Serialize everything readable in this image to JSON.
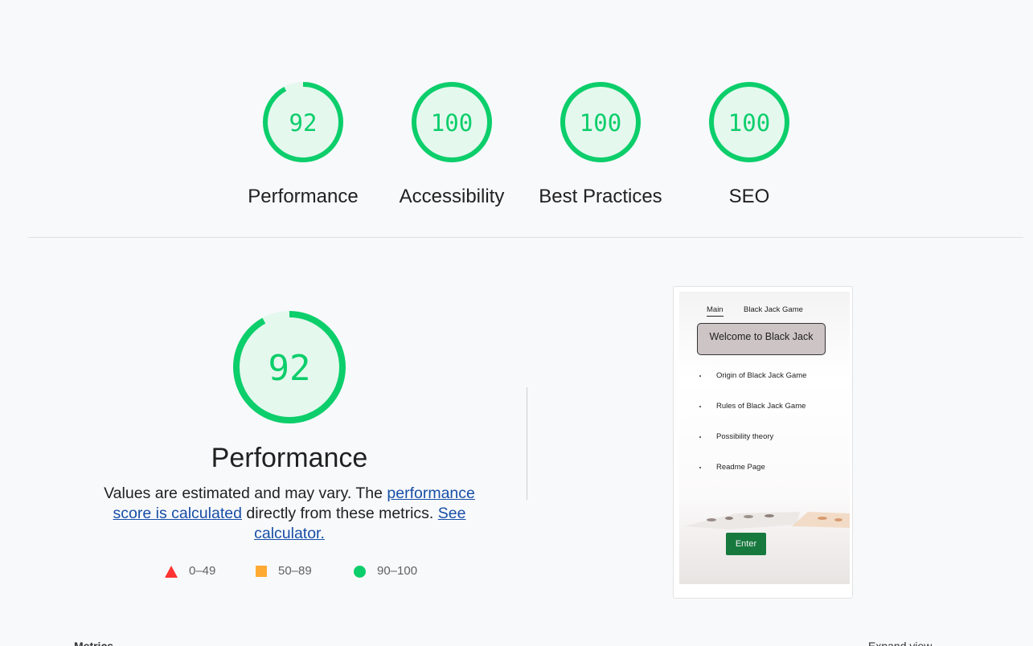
{
  "colors": {
    "pass": "#0cce6b",
    "pass_bg": "#e5f8ee",
    "average": "#ffaa33",
    "fail": "#ff3333",
    "link": "#174ea6",
    "background": "#f8f9fb"
  },
  "gauges": [
    {
      "label": "Performance",
      "score": "92",
      "fraction": 0.92
    },
    {
      "label": "Accessibility",
      "score": "100",
      "fraction": 1.0
    },
    {
      "label": "Best Practices",
      "score": "100",
      "fraction": 1.0
    },
    {
      "label": "SEO",
      "score": "100",
      "fraction": 1.0
    }
  ],
  "performance": {
    "score": "92",
    "fraction": 0.92,
    "title": "Performance",
    "desc_1": "Values are estimated and may vary. The ",
    "link_1": "performance score is calculated",
    "desc_2": " directly from these metrics. ",
    "link_2": "See calculator.",
    "legend": [
      {
        "icon": "triangle-icon",
        "range": "0–49"
      },
      {
        "icon": "square-icon",
        "range": "50–89"
      },
      {
        "icon": "circle-icon",
        "range": "90–100"
      }
    ]
  },
  "screenshot": {
    "nav_main": "Main",
    "nav_game": "Black Jack Game",
    "welcome": "Welcome to Black Jack",
    "items": [
      "Origin of Black Jack Game",
      "Rules of Black Jack Game",
      "Possibility theory",
      "Readme Page"
    ],
    "enter": "Enter"
  },
  "bottom": {
    "left_label": "Metrics",
    "right_label": "Expand view"
  }
}
